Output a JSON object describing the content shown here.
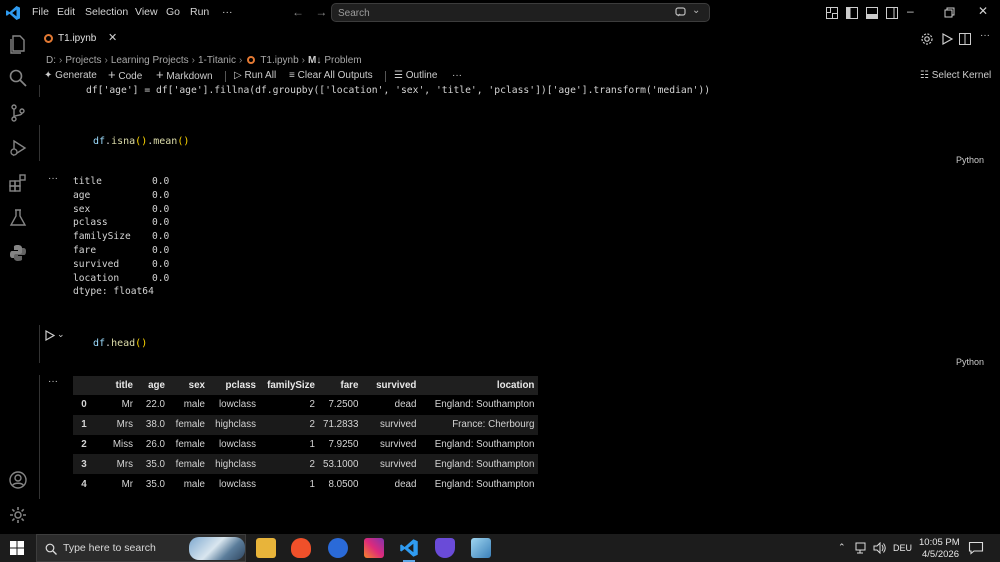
{
  "menu": {
    "file": "File",
    "edit": "Edit",
    "selection": "Selection",
    "view": "View",
    "go": "Go",
    "run": "Run",
    "more": "···"
  },
  "search": {
    "placeholder": "Search"
  },
  "tab": {
    "label": "T1.ipynb",
    "close": "✕"
  },
  "breadcrumb": [
    "D:",
    "Projects",
    "Learning Projects",
    "1-Titanic",
    "T1.ipynb",
    "Problem"
  ],
  "breadcrumb_md_prefix": "M↓",
  "toolbar": {
    "generate": "Generate",
    "code": "Code",
    "markdown": "Markdown",
    "run_all": "Run All",
    "clear_outputs": "Clear All Outputs",
    "outline": "Outline",
    "more": "···",
    "select_kernel": "Select Kernel"
  },
  "cells": {
    "prev_code": "df['age'] = df['age'].fillna(df.groupby(['location', 'sex', 'title', 'pclass'])['age'].transform('median'))",
    "isna_code_obj": "df",
    "isna_code_m1": "isna",
    "isna_code_m2": "mean",
    "head_code_obj": "df",
    "head_code_m1": "head",
    "language": "Python",
    "output_more": "···",
    "isna_output": [
      {
        "name": "title",
        "value": "0.0"
      },
      {
        "name": "age",
        "value": "0.0"
      },
      {
        "name": "sex",
        "value": "0.0"
      },
      {
        "name": "pclass",
        "value": "0.0"
      },
      {
        "name": "familySize",
        "value": "0.0"
      },
      {
        "name": "fare",
        "value": "0.0"
      },
      {
        "name": "survived",
        "value": "0.0"
      },
      {
        "name": "location",
        "value": "0.0"
      }
    ],
    "isna_dtype": "dtype: float64"
  },
  "head_table": {
    "columns": [
      "",
      "title",
      "age",
      "sex",
      "pclass",
      "familySize",
      "fare",
      "survived",
      "location"
    ],
    "rows": [
      [
        "0",
        "Mr",
        "22.0",
        "male",
        "lowclass",
        "2",
        "7.2500",
        "dead",
        "England: Southampton"
      ],
      [
        "1",
        "Mrs",
        "38.0",
        "female",
        "highclass",
        "2",
        "71.2833",
        "survived",
        "France: Cherbourg"
      ],
      [
        "2",
        "Miss",
        "26.0",
        "female",
        "lowclass",
        "1",
        "7.9250",
        "survived",
        "England: Southampton"
      ],
      [
        "3",
        "Mrs",
        "35.0",
        "female",
        "highclass",
        "2",
        "53.1000",
        "survived",
        "England: Southampton"
      ],
      [
        "4",
        "Mr",
        "35.0",
        "male",
        "lowclass",
        "1",
        "8.0500",
        "dead",
        "England: Southampton"
      ]
    ]
  },
  "taskbar": {
    "search_placeholder": "Type here to search",
    "language": "DEU",
    "time": "10:05 PM",
    "date": "4/5/2026"
  },
  "colors": {
    "accent": "#007acc",
    "code_yellow": "#dcdcaa",
    "code_blue": "#9cdcfe",
    "code_orange": "#ce9178",
    "bracket_gold": "#ffd700",
    "notebook_icon": "#e37933"
  }
}
